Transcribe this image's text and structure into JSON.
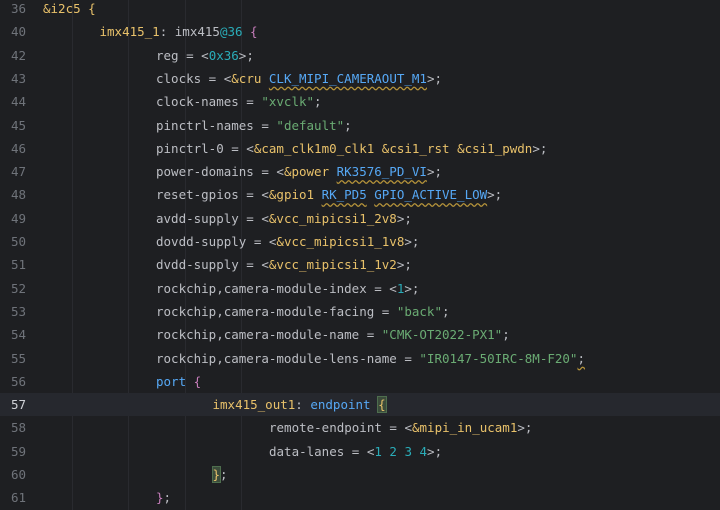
{
  "editor": {
    "current_line": "57",
    "lines": [
      {
        "no": "36",
        "indent": 0,
        "tokens": [
          {
            "t": "&i2c5",
            "c": "c-label"
          },
          {
            "t": " {",
            "c": "c-label"
          }
        ]
      },
      {
        "no": "40",
        "indent": 1,
        "tokens": [
          {
            "t": "imx415_1",
            "c": "c-label"
          },
          {
            "t": ": ",
            "c": "c-punct"
          },
          {
            "t": "imx415",
            "c": "c-normal"
          },
          {
            "t": "@36",
            "c": "c-num"
          },
          {
            "t": " {",
            "c": "c-ref"
          }
        ]
      },
      {
        "no": "42",
        "indent": 2,
        "tokens": [
          {
            "t": "reg = <",
            "c": "c-normal"
          },
          {
            "t": "0x36",
            "c": "c-num"
          },
          {
            "t": ">;",
            "c": "c-normal"
          }
        ]
      },
      {
        "no": "43",
        "indent": 2,
        "tokens": [
          {
            "t": "clocks = <",
            "c": "c-normal"
          },
          {
            "t": "&cru",
            "c": "c-label"
          },
          {
            "t": " ",
            "c": "c-normal"
          },
          {
            "t": "CLK_MIPI_CAMERAOUT_M1",
            "c": "c-blue warn"
          },
          {
            "t": ">;",
            "c": "c-normal"
          }
        ]
      },
      {
        "no": "44",
        "indent": 2,
        "tokens": [
          {
            "t": "clock-names = ",
            "c": "c-normal"
          },
          {
            "t": "\"xvclk\"",
            "c": "c-str"
          },
          {
            "t": ";",
            "c": "c-normal"
          }
        ]
      },
      {
        "no": "45",
        "indent": 2,
        "tokens": [
          {
            "t": "pinctrl-names = ",
            "c": "c-normal"
          },
          {
            "t": "\"default\"",
            "c": "c-str"
          },
          {
            "t": ";",
            "c": "c-normal"
          }
        ]
      },
      {
        "no": "46",
        "indent": 2,
        "tokens": [
          {
            "t": "pinctrl-0 = <",
            "c": "c-normal"
          },
          {
            "t": "&cam_clk1m0_clk1",
            "c": "c-label"
          },
          {
            "t": " ",
            "c": "c-normal"
          },
          {
            "t": "&csi1_rst",
            "c": "c-label"
          },
          {
            "t": " ",
            "c": "c-normal"
          },
          {
            "t": "&csi1_pwdn",
            "c": "c-label"
          },
          {
            "t": ">;",
            "c": "c-normal"
          }
        ]
      },
      {
        "no": "47",
        "indent": 2,
        "tokens": [
          {
            "t": "power-domains = <",
            "c": "c-normal"
          },
          {
            "t": "&power",
            "c": "c-label"
          },
          {
            "t": " ",
            "c": "c-normal"
          },
          {
            "t": "RK3576_PD_VI",
            "c": "c-blue warn"
          },
          {
            "t": ">;",
            "c": "c-normal"
          }
        ]
      },
      {
        "no": "48",
        "indent": 2,
        "tokens": [
          {
            "t": "reset-gpios = <",
            "c": "c-normal"
          },
          {
            "t": "&gpio1",
            "c": "c-label"
          },
          {
            "t": " ",
            "c": "c-normal"
          },
          {
            "t": "RK_PD5",
            "c": "c-blue warn"
          },
          {
            "t": " ",
            "c": "c-normal"
          },
          {
            "t": "GPIO_ACTIVE_LOW",
            "c": "c-blue warn"
          },
          {
            "t": ">;",
            "c": "c-normal"
          }
        ]
      },
      {
        "no": "49",
        "indent": 2,
        "tokens": [
          {
            "t": "avdd-supply = <",
            "c": "c-normal"
          },
          {
            "t": "&vcc_mipicsi1_2v8",
            "c": "c-label"
          },
          {
            "t": ">;",
            "c": "c-normal"
          }
        ]
      },
      {
        "no": "50",
        "indent": 2,
        "tokens": [
          {
            "t": "dovdd-supply = <",
            "c": "c-normal"
          },
          {
            "t": "&vcc_mipicsi1_1v8",
            "c": "c-label"
          },
          {
            "t": ">;",
            "c": "c-normal"
          }
        ]
      },
      {
        "no": "51",
        "indent": 2,
        "tokens": [
          {
            "t": "dvdd-supply = <",
            "c": "c-normal"
          },
          {
            "t": "&vcc_mipicsi1_1v2",
            "c": "c-label"
          },
          {
            "t": ">;",
            "c": "c-normal"
          }
        ]
      },
      {
        "no": "52",
        "indent": 2,
        "tokens": [
          {
            "t": "rockchip,camera-module-index = <",
            "c": "c-normal"
          },
          {
            "t": "1",
            "c": "c-num"
          },
          {
            "t": ">;",
            "c": "c-normal"
          }
        ]
      },
      {
        "no": "53",
        "indent": 2,
        "tokens": [
          {
            "t": "rockchip,camera-module-facing = ",
            "c": "c-normal"
          },
          {
            "t": "\"back\"",
            "c": "c-str"
          },
          {
            "t": ";",
            "c": "c-normal"
          }
        ]
      },
      {
        "no": "54",
        "indent": 2,
        "tokens": [
          {
            "t": "rockchip,camera-module-name = ",
            "c": "c-normal"
          },
          {
            "t": "\"CMK-OT2022-PX1\"",
            "c": "c-str"
          },
          {
            "t": ";",
            "c": "c-normal"
          }
        ]
      },
      {
        "no": "55",
        "indent": 2,
        "tokens": [
          {
            "t": "rockchip,camera-module-lens-name = ",
            "c": "c-normal"
          },
          {
            "t": "\"IR0147-50IRC-8M-F20\"",
            "c": "c-str"
          },
          {
            "t": ";",
            "c": "c-normal warn"
          }
        ]
      },
      {
        "no": "56",
        "indent": 2,
        "tokens": [
          {
            "t": "port",
            "c": "c-blue"
          },
          {
            "t": " {",
            "c": "c-ref"
          }
        ]
      },
      {
        "no": "57",
        "indent": 3,
        "tokens": [
          {
            "t": "imx415_out1",
            "c": "c-label"
          },
          {
            "t": ": ",
            "c": "c-punct"
          },
          {
            "t": "endpoint",
            "c": "c-blue"
          },
          {
            "t": " ",
            "c": "c-normal"
          },
          {
            "t": "{",
            "c": "c-label match"
          }
        ]
      },
      {
        "no": "58",
        "indent": 4,
        "tokens": [
          {
            "t": "remote-endpoint = <",
            "c": "c-normal"
          },
          {
            "t": "&mipi_in_ucam1",
            "c": "c-label"
          },
          {
            "t": ">;",
            "c": "c-normal"
          }
        ]
      },
      {
        "no": "59",
        "indent": 4,
        "tokens": [
          {
            "t": "data-lanes = <",
            "c": "c-normal"
          },
          {
            "t": "1 2 3 4",
            "c": "c-num"
          },
          {
            "t": ">;",
            "c": "c-normal"
          }
        ]
      },
      {
        "no": "60",
        "indent": 3,
        "tokens": [
          {
            "t": "}",
            "c": "c-label match"
          },
          {
            "t": ";",
            "c": "c-normal"
          }
        ]
      },
      {
        "no": "61",
        "indent": 2,
        "tokens": [
          {
            "t": "}",
            "c": "c-ref"
          },
          {
            "t": ";",
            "c": "c-normal"
          }
        ]
      }
    ]
  }
}
